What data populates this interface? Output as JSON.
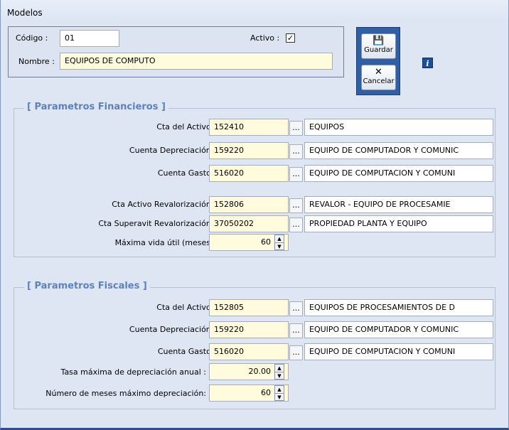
{
  "window": {
    "title": "Modelos"
  },
  "header": {
    "codigo_label": "Código :",
    "codigo_value": "01",
    "activo_label": "Activo :",
    "activo_checked": true,
    "nombre_label": "Nombre :",
    "nombre_value": "EQUIPOS DE COMPUTO"
  },
  "toolbar": {
    "save_label": "Guardar",
    "save_icon": "save-icon",
    "cancel_label": "Cancelar",
    "cancel_icon": "cancel-icon",
    "info_icon": "info-icon",
    "info_glyph": "i",
    "dots_glyph": "...",
    "spin_up": "▲",
    "spin_down": "▼",
    "check_glyph": "✓",
    "save_glyph": "💾",
    "cancel_glyph": "✕"
  },
  "financieros": {
    "title": "[ Parametros  Financieros ]",
    "rows": [
      {
        "label": "Cta  del Activo :",
        "code": "152410",
        "desc": "EQUIPOS"
      },
      {
        "label": "Cuenta Depreciación :",
        "code": "159220",
        "desc": "EQUIPO DE COMPUTADOR Y COMUNIC"
      },
      {
        "label": "Cuenta Gasto :",
        "code": "516020",
        "desc": "EQUIPO DE COMPUTACION Y COMUNI"
      },
      {
        "label": "Cta Activo Revalorización :",
        "code": "152806",
        "desc": "REVALOR - EQUIPO DE PROCESAMIE"
      },
      {
        "label": "Cta Superavit Revalorización :",
        "code": "37050202",
        "desc": "PROPIEDAD PLANTA Y EQUIPO"
      }
    ],
    "vida_label": "Máxima vida útil (meses):",
    "vida_value": "60"
  },
  "fiscales": {
    "title": "[ Parametros  Fiscales ]",
    "rows": [
      {
        "label": "Cta  del Activo :",
        "code": "152805",
        "desc": "EQUIPOS DE PROCESAMIENTOS DE D"
      },
      {
        "label": "Cuenta Depreciación :",
        "code": "159220",
        "desc": "EQUIPO DE COMPUTADOR Y COMUNIC"
      },
      {
        "label": "Cuenta Gasto :",
        "code": "516020",
        "desc": "EQUIPO DE COMPUTACION Y COMUNI"
      }
    ],
    "tasa_label": "Tasa máxima de depreciación anual :",
    "tasa_value": "20.00",
    "meses_label": "Número de meses máximo depreciación:",
    "meses_value": "60"
  }
}
